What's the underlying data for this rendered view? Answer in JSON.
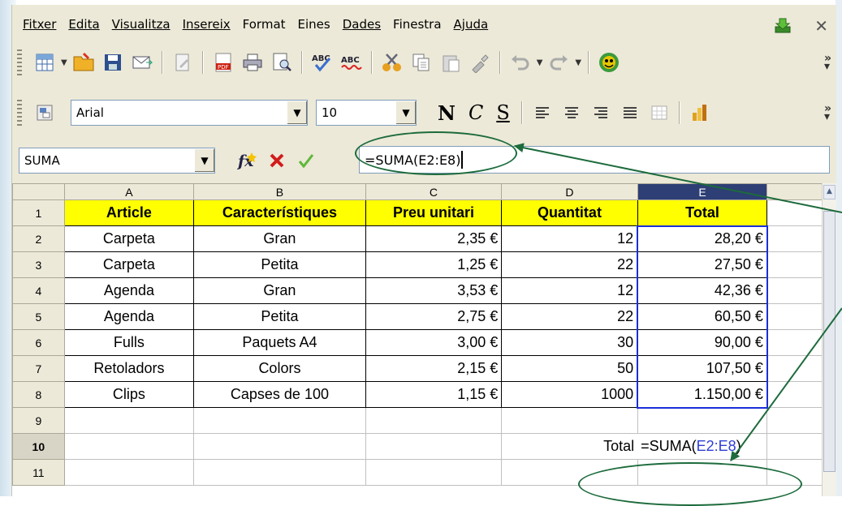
{
  "menu": [
    "Fitxer",
    "Edita",
    "Visualitza",
    "Insereix",
    "Format",
    "Eines",
    "Dades",
    "Finestra",
    "Ajuda"
  ],
  "font": {
    "name": "Arial",
    "size": "10"
  },
  "namebox": "SUMA",
  "formula": "=SUMA(E2:E8)",
  "format_buttons": {
    "bold": "N",
    "italic": "C",
    "underline": "S"
  },
  "columns": [
    "A",
    "B",
    "C",
    "D",
    "E"
  ],
  "rows": [
    {
      "n": "1",
      "cells": [
        "Article",
        "Característiques",
        "Preu unitari",
        "Quantitat",
        "Total"
      ]
    },
    {
      "n": "2",
      "cells": [
        "Carpeta",
        "Gran",
        "2,35 €",
        "12",
        "28,20 €"
      ]
    },
    {
      "n": "3",
      "cells": [
        "Carpeta",
        "Petita",
        "1,25 €",
        "22",
        "27,50 €"
      ]
    },
    {
      "n": "4",
      "cells": [
        "Agenda",
        "Gran",
        "3,53 €",
        "12",
        "42,36 €"
      ]
    },
    {
      "n": "5",
      "cells": [
        "Agenda",
        "Petita",
        "2,75 €",
        "22",
        "60,50 €"
      ]
    },
    {
      "n": "6",
      "cells": [
        "Fulls",
        "Paquets A4",
        "3,00 €",
        "30",
        "90,00 €"
      ]
    },
    {
      "n": "7",
      "cells": [
        "Retoladors",
        "Colors",
        "2,15 €",
        "50",
        "107,50 €"
      ]
    },
    {
      "n": "8",
      "cells": [
        "Clips",
        "Capses de 100",
        "1,15 €",
        "1000",
        "1.150,00 €"
      ]
    },
    {
      "n": "9",
      "cells": [
        "",
        "",
        "",
        "",
        ""
      ]
    },
    {
      "n": "10",
      "cells": [
        "",
        "",
        "",
        "",
        ""
      ]
    },
    {
      "n": "11",
      "cells": [
        "",
        "",
        "",
        "",
        ""
      ]
    }
  ],
  "row10": {
    "label": "Total",
    "formula_prefix": "=SUMA(",
    "formula_range": "E2:E8",
    "formula_suffix": ")"
  },
  "colors": {
    "annotation": "#1d6b3c",
    "header_yellow": "#ffff00",
    "selection": "#1a2fd8",
    "col_header_selected": "#2d3f74"
  }
}
